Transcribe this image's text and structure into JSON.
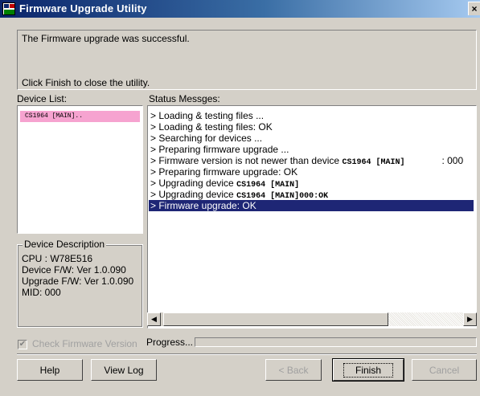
{
  "window": {
    "title": "Firmware Upgrade Utility",
    "close_glyph": "×"
  },
  "message": {
    "line1": "The Firmware upgrade was successful.",
    "line2": "Click Finish to close the utility."
  },
  "device_list": {
    "label": "Device List:",
    "items": [
      "CS1964 [MAIN].."
    ]
  },
  "device_description": {
    "title": "Device Description",
    "lines": [
      "CPU : W78E516",
      "Device F/W: Ver 1.0.090",
      "Upgrade F/W: Ver 1.0.090",
      "MID: 000"
    ]
  },
  "status": {
    "label": "Status Messges:",
    "lines": [
      {
        "text": "> Loading & testing files ..."
      },
      {
        "text": "> Loading & testing files: OK"
      },
      {
        "text": "> Searching for devices ..."
      },
      {
        "text": "> Preparing firmware upgrade ..."
      },
      {
        "text": "> Firmware version is not newer than device ",
        "device": "CS1964 [MAIN]",
        "suffix": ": 000"
      },
      {
        "text": "> Preparing firmware upgrade: OK"
      },
      {
        "text": "> Upgrading device ",
        "device": "CS1964 [MAIN]"
      },
      {
        "text": "> Upgrading device ",
        "device": "CS1964 [MAIN]000:OK"
      },
      {
        "text": "> Firmware upgrade: OK",
        "selected": true
      }
    ]
  },
  "check_firmware": {
    "label": "Check Firmware Version",
    "checked": true,
    "enabled": false
  },
  "progress": {
    "label": "Progress...",
    "value": 0
  },
  "buttons": {
    "help": "Help",
    "view_log": "View Log",
    "back": "< Back",
    "finish": "Finish",
    "cancel": "Cancel"
  },
  "colors": {
    "selected_device": "#f6a3d0",
    "selected_status": "#1e2675"
  }
}
